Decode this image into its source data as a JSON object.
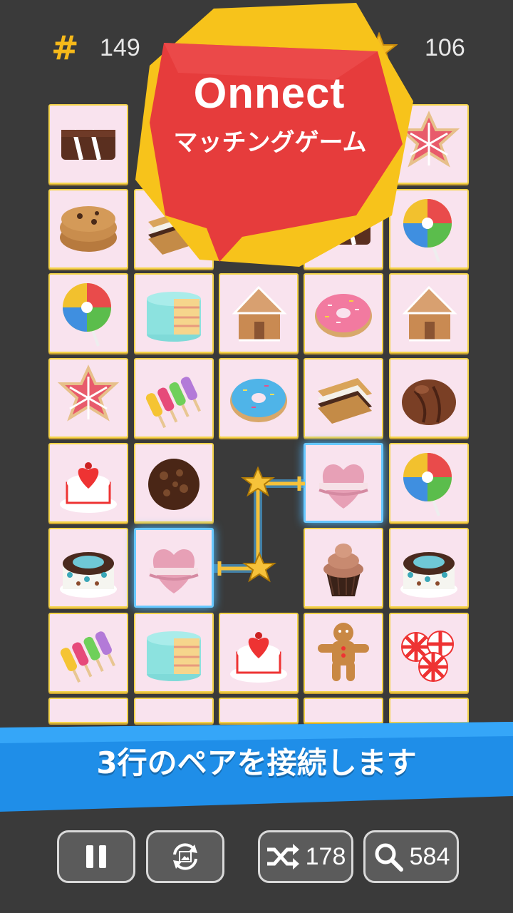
{
  "hud": {
    "moves_symbol": "#",
    "moves": "149",
    "score": "106",
    "star_icon": "star-icon",
    "accent": "#f6b91a"
  },
  "logo": {
    "title": "Onnect",
    "subtitle": "マッチングゲーム"
  },
  "banner": {
    "text": "3行のペアを接続します",
    "color": "#1f8ee8"
  },
  "board": {
    "rows": [
      [
        "chocolate-bar",
        "hidden",
        "hidden",
        "hidden",
        "snowflake-cookie"
      ],
      [
        "cookies",
        "smores",
        "hidden",
        "chocolate-bar",
        "lollipop"
      ],
      [
        "lollipop",
        "cake-slice",
        "gingerbread-house",
        "pink-donut",
        "gingerbread-house"
      ],
      [
        "snowflake-cookie",
        "popsicles",
        "blue-donut",
        "smores",
        "chocolate-truffle"
      ],
      [
        "heart-cake",
        "chocolate-ball",
        "empty",
        "macaron",
        "lollipop"
      ],
      [
        "polka-cake",
        "macaron",
        "empty",
        "cupcake",
        "polka-cake"
      ],
      [
        "popsicles",
        "cake-slice",
        "heart-cake",
        "gingerbread-man",
        "peppermints"
      ],
      [
        "partial",
        "partial",
        "partial",
        "partial",
        "partial"
      ]
    ],
    "selected": [
      "macaron"
    ]
  },
  "buttons": {
    "pause": {
      "icon": "pause-icon"
    },
    "rotate": {
      "icon": "rotate-image-icon"
    },
    "shuffle": {
      "icon": "shuffle-icon",
      "count": "178"
    },
    "hint": {
      "icon": "search-icon",
      "count": "584"
    }
  }
}
